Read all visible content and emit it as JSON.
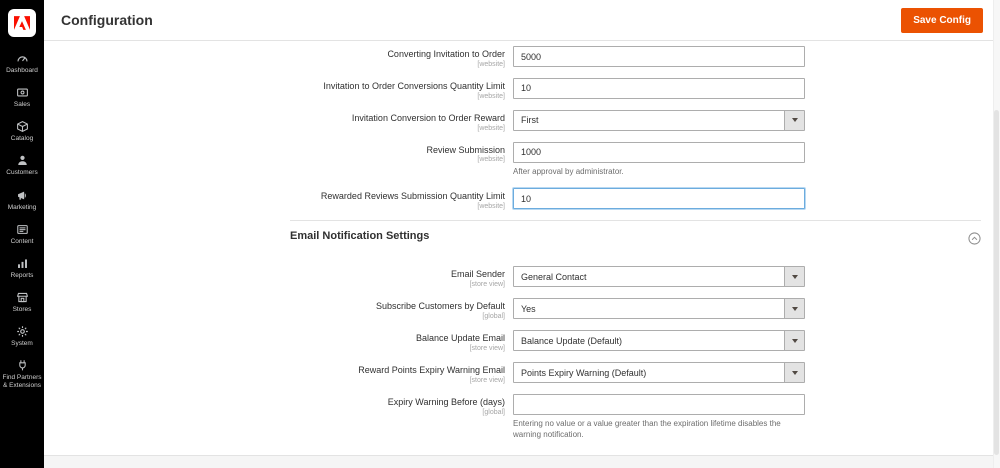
{
  "colors": {
    "accent_orange": "#eb5202",
    "focus_blue": "#6cacde",
    "sidebar_bg": "#000000",
    "adobe_red": "#fa0f00",
    "border_gray": "#adadad"
  },
  "header": {
    "title": "Configuration",
    "save_button": "Save Config"
  },
  "sidebar": {
    "items": [
      {
        "label": "Dashboard",
        "icon": "dashboard-icon"
      },
      {
        "label": "Sales",
        "icon": "sales-icon"
      },
      {
        "label": "Catalog",
        "icon": "catalog-icon"
      },
      {
        "label": "Customers",
        "icon": "customers-icon"
      },
      {
        "label": "Marketing",
        "icon": "marketing-icon"
      },
      {
        "label": "Content",
        "icon": "content-icon"
      },
      {
        "label": "Reports",
        "icon": "reports-icon"
      },
      {
        "label": "Stores",
        "icon": "stores-icon"
      },
      {
        "label": "System",
        "icon": "system-icon"
      },
      {
        "label": "Find Partners & Extensions",
        "icon": "extensions-icon"
      }
    ]
  },
  "form": {
    "general": [
      {
        "label": "Converting Invitation to Order",
        "scope": "[website]",
        "type": "text",
        "value": "5000"
      },
      {
        "label": "Invitation to Order Conversions Quantity Limit",
        "scope": "[website]",
        "type": "text",
        "value": "10"
      },
      {
        "label": "Invitation Conversion to Order Reward",
        "scope": "[website]",
        "type": "select",
        "value": "First"
      },
      {
        "label": "Review Submission",
        "scope": "[website]",
        "type": "text",
        "value": "1000",
        "note": "After approval by administrator."
      },
      {
        "label": "Rewarded Reviews Submission Quantity Limit",
        "scope": "[website]",
        "type": "text",
        "value": "10",
        "focused": true
      }
    ],
    "email": {
      "title": "Email Notification Settings",
      "collapse_icon": "chevron-up-circle",
      "fields": [
        {
          "label": "Email Sender",
          "scope": "[store view]",
          "type": "select",
          "value": "General Contact"
        },
        {
          "label": "Subscribe Customers by Default",
          "scope": "[global]",
          "type": "select",
          "value": "Yes"
        },
        {
          "label": "Balance Update Email",
          "scope": "[store view]",
          "type": "select",
          "value": "Balance Update (Default)"
        },
        {
          "label": "Reward Points Expiry Warning Email",
          "scope": "[store view]",
          "type": "select",
          "value": "Points Expiry Warning (Default)"
        },
        {
          "label": "Expiry Warning Before (days)",
          "scope": "[global]",
          "type": "text",
          "value": "",
          "note": "Entering no value or a value greater than the expiration lifetime disables the warning notification."
        }
      ]
    }
  }
}
